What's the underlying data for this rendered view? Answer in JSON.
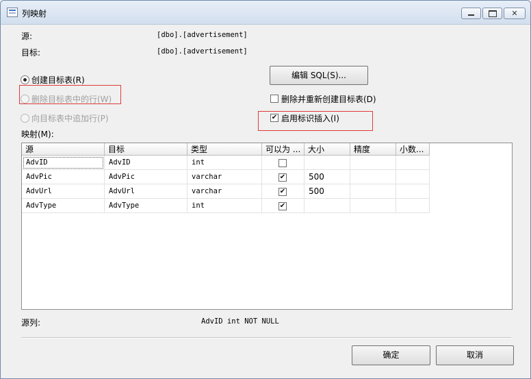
{
  "window": {
    "title": "列映射"
  },
  "source": {
    "label": "源:",
    "value": "[dbo].[advertisement]"
  },
  "target": {
    "label": "目标:",
    "value": "[dbo].[advertisement]"
  },
  "options": {
    "create_table": "创建目标表(R)",
    "delete_rows": "删除目标表中的行(W)",
    "append_rows": "向目标表中追加行(P)",
    "edit_sql": "编辑 SQL(S)...",
    "drop_recreate": "删除并重新创建目标表(D)",
    "identity_insert": "启用标识插入(I)"
  },
  "mappings": {
    "label": "映射(M):",
    "columns": [
      "源",
      "目标",
      "类型",
      "可以为 ...",
      "大小",
      "精度",
      "小数..."
    ],
    "rows": [
      {
        "source": "AdvID",
        "target": "AdvID",
        "type": "int",
        "nullable": false,
        "size": "",
        "precision": "",
        "scale": ""
      },
      {
        "source": "AdvPic",
        "target": "AdvPic",
        "type": "varchar",
        "nullable": true,
        "size": "500",
        "precision": "",
        "scale": ""
      },
      {
        "source": "AdvUrl",
        "target": "AdvUrl",
        "type": "varchar",
        "nullable": true,
        "size": "500",
        "precision": "",
        "scale": ""
      },
      {
        "source": "AdvType",
        "target": "AdvType",
        "type": "int",
        "nullable": true,
        "size": "",
        "precision": "",
        "scale": ""
      }
    ]
  },
  "source_column": {
    "label": "源列:",
    "value": "AdvID int NOT NULL"
  },
  "buttons": {
    "ok": "确定",
    "cancel": "取消"
  },
  "state": {
    "create_table": true,
    "delete_rows": false,
    "append_rows": false,
    "drop_recreate": false,
    "identity_insert": true
  },
  "icons": {
    "minimize": "minimize-icon",
    "maximize": "maximize-icon",
    "close": "close-icon",
    "app": "app-icon"
  },
  "colors": {
    "highlight_box": "#e03a3a"
  }
}
